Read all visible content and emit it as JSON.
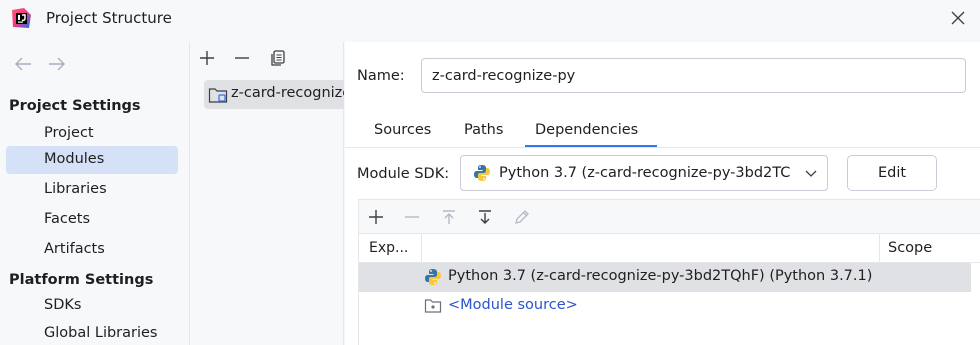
{
  "window": {
    "title": "Project Structure",
    "app_icon": "intellij-idea-icon",
    "close_icon": "close-icon"
  },
  "sidebar": {
    "nav": {
      "back_icon": "arrow-left-icon",
      "forward_icon": "arrow-right-icon"
    },
    "sections": [
      {
        "title": "Project Settings",
        "items": [
          {
            "label": "Project",
            "selected": false
          },
          {
            "label": "Modules",
            "selected": true
          },
          {
            "label": "Libraries",
            "selected": false
          },
          {
            "label": "Facets",
            "selected": false
          },
          {
            "label": "Artifacts",
            "selected": false
          }
        ]
      },
      {
        "title": "Platform Settings",
        "items": [
          {
            "label": "SDKs",
            "selected": false
          },
          {
            "label": "Global Libraries",
            "selected": false
          }
        ]
      }
    ]
  },
  "modules": {
    "toolbar": [
      "add-icon",
      "remove-icon",
      "copy-icon"
    ],
    "items": [
      {
        "label": "z-card-recognize-py",
        "icon": "module-folder-icon",
        "selected": true
      }
    ]
  },
  "detail": {
    "name_label": "Name:",
    "name_value": "z-card-recognize-py",
    "tabs": [
      {
        "label": "Sources",
        "active": false
      },
      {
        "label": "Paths",
        "active": false
      },
      {
        "label": "Dependencies",
        "active": true
      }
    ],
    "sdk_label": "Module SDK:",
    "sdk_value": "Python 3.7 (z-card-recognize-py-3bd2TC",
    "edit_label": "Edit",
    "dep_toolbar": [
      "add-icon",
      "remove-icon",
      "move-up-icon",
      "move-down-icon",
      "edit-icon"
    ],
    "columns": {
      "export": "Exp...",
      "scope": "Scope"
    },
    "rows": [
      {
        "label": "Python 3.7 (z-card-recognize-py-3bd2TQhF) (Python 3.7.1)",
        "icon": "python-icon",
        "selected": true
      },
      {
        "label": "<Module source>",
        "icon": "source-folder-icon",
        "selected": false
      }
    ]
  },
  "colors": {
    "accent": "#3574f0",
    "selection": "#d5e1f7",
    "link": "#2a54c9"
  }
}
